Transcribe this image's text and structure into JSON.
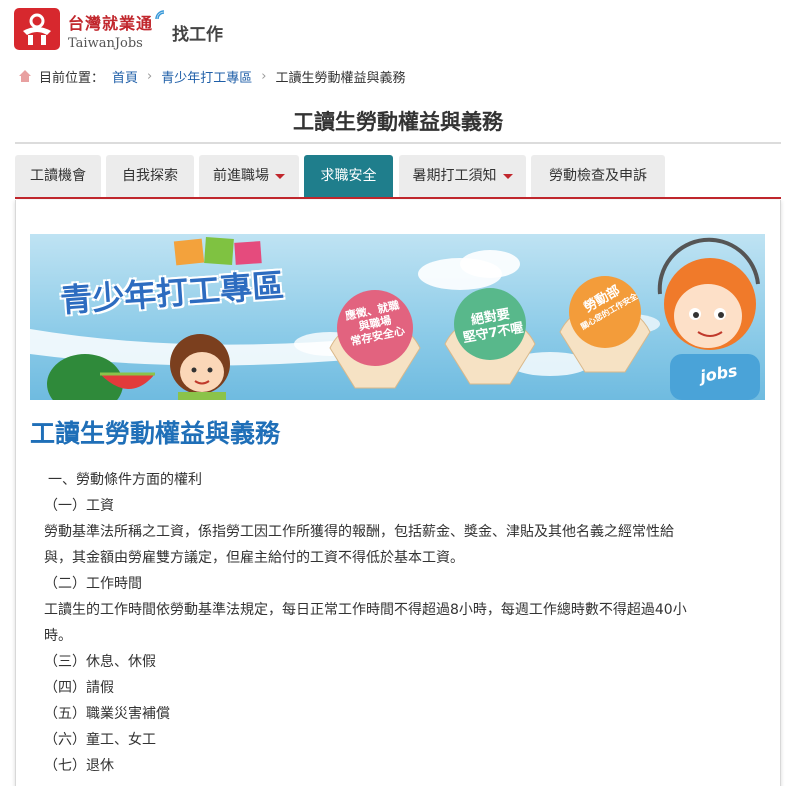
{
  "header": {
    "logo_cn": "台灣就業通",
    "logo_en": "TaiwanJobs",
    "section": "找工作"
  },
  "breadcrumb": {
    "prefix": "目前位置：",
    "items": [
      "首頁",
      "青少年打工專區",
      "工讀生勞動權益與義務"
    ]
  },
  "page_title": "工讀生勞動權益與義務",
  "tabs": [
    {
      "label": "工讀機會",
      "dropdown": false,
      "active": false
    },
    {
      "label": "自我探索",
      "dropdown": false,
      "active": false
    },
    {
      "label": "前進職場",
      "dropdown": true,
      "active": false
    },
    {
      "label": "求職安全",
      "dropdown": false,
      "active": true
    },
    {
      "label": "暑期打工須知",
      "dropdown": true,
      "active": false
    },
    {
      "label": "勞動檢查及申訴",
      "dropdown": false,
      "active": false
    }
  ],
  "banner": {
    "title": "青少年打工專區",
    "fan1": [
      "應徵、就職",
      "與職場",
      "常存安全心"
    ],
    "fan2": [
      "絕對要",
      "堅守7不喔"
    ],
    "fan3": [
      "勞動部",
      "關心您的工作安全"
    ],
    "shirt": "jobs"
  },
  "article": {
    "title": "工讀生勞動權益與義務",
    "lines": [
      "一、勞動條件方面的權利",
      "（一）工資",
      "勞動基準法所稱之工資，係指勞工因工作所獲得的報酬，包括薪金、獎金、津貼及其他名義之經常性給",
      "與，其金額由勞雇雙方議定，但雇主給付的工資不得低於基本工資。",
      "（二）工作時間",
      "工讀生的工作時間依勞動基準法規定，每日正常工作時間不得超過8小時，每週工作總時數不得超過40小",
      "時。",
      "（三）休息、休假",
      "（四）請假",
      "（五）職業災害補償",
      "（六）童工、女工",
      "（七）退休"
    ]
  },
  "colors": {
    "brand_red": "#c1272d",
    "tab_active": "#1f7e8c",
    "link_blue": "#1f5fa8",
    "heading_blue": "#1f6fb8"
  }
}
